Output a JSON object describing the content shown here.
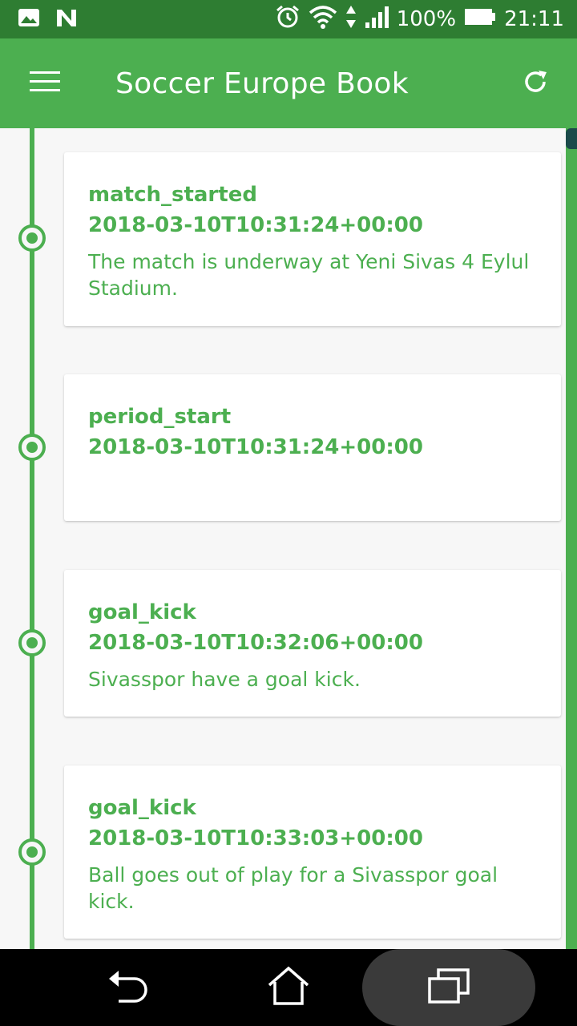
{
  "status_bar": {
    "battery": "100%",
    "time": "21:11"
  },
  "app_bar": {
    "title": "Soccer Europe Book"
  },
  "events": [
    {
      "type": "match_started",
      "time": "2018-03-10T10:31:24+00:00",
      "description": "The match is underway at Yeni Sivas 4 Eylul Stadium."
    },
    {
      "type": "period_start",
      "time": "2018-03-10T10:31:24+00:00",
      "description": ""
    },
    {
      "type": "goal_kick",
      "time": "2018-03-10T10:32:06+00:00",
      "description": "Sivasspor have a goal kick."
    },
    {
      "type": "goal_kick",
      "time": "2018-03-10T10:33:03+00:00",
      "description": "Ball goes out of play for a Sivasspor goal kick."
    }
  ],
  "colors": {
    "primary": "#4caf50",
    "primary_dark": "#2e7d32"
  }
}
